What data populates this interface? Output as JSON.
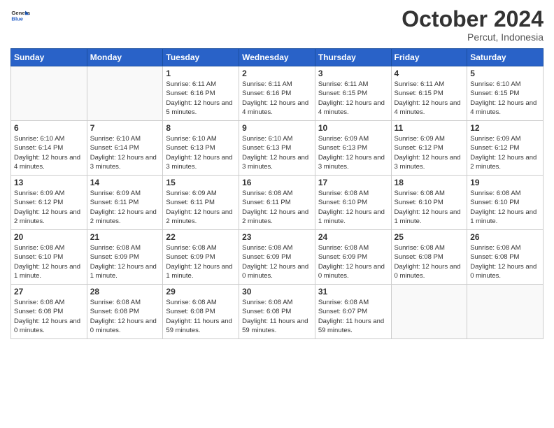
{
  "header": {
    "logo": {
      "general": "General",
      "blue": "Blue"
    },
    "title": "October 2024",
    "location": "Percut, Indonesia"
  },
  "days_of_week": [
    "Sunday",
    "Monday",
    "Tuesday",
    "Wednesday",
    "Thursday",
    "Friday",
    "Saturday"
  ],
  "weeks": [
    [
      {
        "day": "",
        "info": ""
      },
      {
        "day": "",
        "info": ""
      },
      {
        "day": "1",
        "info": "Sunrise: 6:11 AM\nSunset: 6:16 PM\nDaylight: 12 hours and 5 minutes."
      },
      {
        "day": "2",
        "info": "Sunrise: 6:11 AM\nSunset: 6:16 PM\nDaylight: 12 hours and 4 minutes."
      },
      {
        "day": "3",
        "info": "Sunrise: 6:11 AM\nSunset: 6:15 PM\nDaylight: 12 hours and 4 minutes."
      },
      {
        "day": "4",
        "info": "Sunrise: 6:11 AM\nSunset: 6:15 PM\nDaylight: 12 hours and 4 minutes."
      },
      {
        "day": "5",
        "info": "Sunrise: 6:10 AM\nSunset: 6:15 PM\nDaylight: 12 hours and 4 minutes."
      }
    ],
    [
      {
        "day": "6",
        "info": "Sunrise: 6:10 AM\nSunset: 6:14 PM\nDaylight: 12 hours and 4 minutes."
      },
      {
        "day": "7",
        "info": "Sunrise: 6:10 AM\nSunset: 6:14 PM\nDaylight: 12 hours and 3 minutes."
      },
      {
        "day": "8",
        "info": "Sunrise: 6:10 AM\nSunset: 6:13 PM\nDaylight: 12 hours and 3 minutes."
      },
      {
        "day": "9",
        "info": "Sunrise: 6:10 AM\nSunset: 6:13 PM\nDaylight: 12 hours and 3 minutes."
      },
      {
        "day": "10",
        "info": "Sunrise: 6:09 AM\nSunset: 6:13 PM\nDaylight: 12 hours and 3 minutes."
      },
      {
        "day": "11",
        "info": "Sunrise: 6:09 AM\nSunset: 6:12 PM\nDaylight: 12 hours and 3 minutes."
      },
      {
        "day": "12",
        "info": "Sunrise: 6:09 AM\nSunset: 6:12 PM\nDaylight: 12 hours and 2 minutes."
      }
    ],
    [
      {
        "day": "13",
        "info": "Sunrise: 6:09 AM\nSunset: 6:12 PM\nDaylight: 12 hours and 2 minutes."
      },
      {
        "day": "14",
        "info": "Sunrise: 6:09 AM\nSunset: 6:11 PM\nDaylight: 12 hours and 2 minutes."
      },
      {
        "day": "15",
        "info": "Sunrise: 6:09 AM\nSunset: 6:11 PM\nDaylight: 12 hours and 2 minutes."
      },
      {
        "day": "16",
        "info": "Sunrise: 6:08 AM\nSunset: 6:11 PM\nDaylight: 12 hours and 2 minutes."
      },
      {
        "day": "17",
        "info": "Sunrise: 6:08 AM\nSunset: 6:10 PM\nDaylight: 12 hours and 1 minute."
      },
      {
        "day": "18",
        "info": "Sunrise: 6:08 AM\nSunset: 6:10 PM\nDaylight: 12 hours and 1 minute."
      },
      {
        "day": "19",
        "info": "Sunrise: 6:08 AM\nSunset: 6:10 PM\nDaylight: 12 hours and 1 minute."
      }
    ],
    [
      {
        "day": "20",
        "info": "Sunrise: 6:08 AM\nSunset: 6:10 PM\nDaylight: 12 hours and 1 minute."
      },
      {
        "day": "21",
        "info": "Sunrise: 6:08 AM\nSunset: 6:09 PM\nDaylight: 12 hours and 1 minute."
      },
      {
        "day": "22",
        "info": "Sunrise: 6:08 AM\nSunset: 6:09 PM\nDaylight: 12 hours and 1 minute."
      },
      {
        "day": "23",
        "info": "Sunrise: 6:08 AM\nSunset: 6:09 PM\nDaylight: 12 hours and 0 minutes."
      },
      {
        "day": "24",
        "info": "Sunrise: 6:08 AM\nSunset: 6:09 PM\nDaylight: 12 hours and 0 minutes."
      },
      {
        "day": "25",
        "info": "Sunrise: 6:08 AM\nSunset: 6:08 PM\nDaylight: 12 hours and 0 minutes."
      },
      {
        "day": "26",
        "info": "Sunrise: 6:08 AM\nSunset: 6:08 PM\nDaylight: 12 hours and 0 minutes."
      }
    ],
    [
      {
        "day": "27",
        "info": "Sunrise: 6:08 AM\nSunset: 6:08 PM\nDaylight: 12 hours and 0 minutes."
      },
      {
        "day": "28",
        "info": "Sunrise: 6:08 AM\nSunset: 6:08 PM\nDaylight: 12 hours and 0 minutes."
      },
      {
        "day": "29",
        "info": "Sunrise: 6:08 AM\nSunset: 6:08 PM\nDaylight: 11 hours and 59 minutes."
      },
      {
        "day": "30",
        "info": "Sunrise: 6:08 AM\nSunset: 6:08 PM\nDaylight: 11 hours and 59 minutes."
      },
      {
        "day": "31",
        "info": "Sunrise: 6:08 AM\nSunset: 6:07 PM\nDaylight: 11 hours and 59 minutes."
      },
      {
        "day": "",
        "info": ""
      },
      {
        "day": "",
        "info": ""
      }
    ]
  ]
}
